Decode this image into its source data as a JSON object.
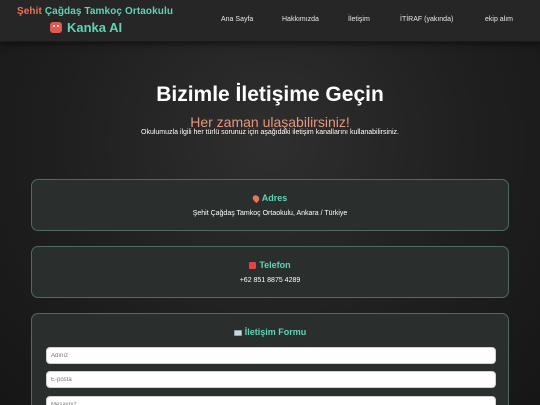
{
  "header": {
    "school_accent": "Şehit",
    "school_rest": " Çağdaş Tamkoç Ortaokulu",
    "brand": "Kanka AI",
    "nav": [
      "Ana Sayfa",
      "Hakkımızda",
      "İletişim",
      "İTİRAF (yakında)",
      "ekip alım"
    ]
  },
  "hero": {
    "title": "Bizimle İletişime Geçin",
    "subtitle": "Her zaman ulaşabilirsiniz!",
    "description": "Okulumuzla ilgili her türlü sorunuz için aşağıdaki iletişim kanallarını kullanabilirsiniz."
  },
  "address": {
    "title": "Adres",
    "text": "Şehit Çağdaş Tamkoç Ortaokulu, Ankara / Türkiye",
    "icon": "pin-icon"
  },
  "phone": {
    "title": "Telefon",
    "text": "+62 851 8875 4289",
    "icon": "phone-icon"
  },
  "form": {
    "title": "İletişim Formu",
    "icon": "envelope-icon",
    "name_placeholder": "Adınız",
    "email_placeholder": "E-posta",
    "message_placeholder": "Mesajınız"
  },
  "colors": {
    "accent": "#5fd3b6",
    "secondary": "#e8957c",
    "background": "#1f1f1f"
  }
}
